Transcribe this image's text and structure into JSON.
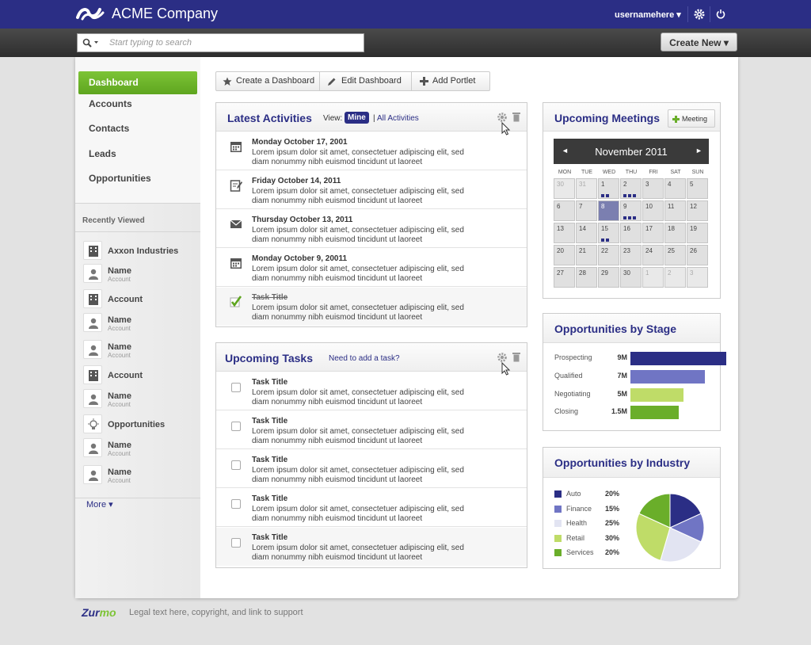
{
  "app": {
    "brand": "ACME Company",
    "username": "usernamehere ▾"
  },
  "search": {
    "placeholder": "Start typing to search"
  },
  "create_new": "Create New ▾",
  "nav": [
    {
      "label": "Dashboard",
      "active": true
    },
    {
      "label": "Accounts"
    },
    {
      "label": "Contacts"
    },
    {
      "label": "Leads"
    },
    {
      "label": "Opportunities"
    }
  ],
  "recently_viewed": {
    "title": "Recently Viewed",
    "items": [
      {
        "name": "Axxon Industries",
        "sub": "",
        "icon": "building-icon"
      },
      {
        "name": "Name",
        "sub": "Account",
        "icon": "person-icon"
      },
      {
        "name": "Account",
        "sub": "",
        "icon": "building-icon"
      },
      {
        "name": "Name",
        "sub": "Account",
        "icon": "person-icon"
      },
      {
        "name": "Name",
        "sub": "Account",
        "icon": "person-icon"
      },
      {
        "name": "Account",
        "sub": "",
        "icon": "building-icon"
      },
      {
        "name": "Name",
        "sub": "Account",
        "icon": "person-icon"
      },
      {
        "name": "Opportunities",
        "sub": "",
        "icon": "lightbulb-icon"
      },
      {
        "name": "Name",
        "sub": "Account",
        "icon": "person-icon"
      },
      {
        "name": "Name",
        "sub": "Account",
        "icon": "person-icon"
      }
    ],
    "more": "More ▾"
  },
  "toolbar": {
    "create": "Create a Dashboard",
    "edit": "Edit Dashboard",
    "add": "Add Portlet"
  },
  "latest": {
    "title": "Latest Activities",
    "view_label": "View:",
    "mine": "Mine",
    "sep": "|",
    "all": "All Activities",
    "rows": [
      {
        "title": "Monday October 17, 2001",
        "icon": "calendar-icon",
        "line1": "Lorem ipsum dolor sit amet, consectetuer adipiscing elit, sed",
        "line2": "diam nonummy nibh euismod tincidunt ut laoreet"
      },
      {
        "title": "Friday October 14, 2011",
        "icon": "note-icon",
        "line1": "Lorem ipsum dolor sit amet, consectetuer adipiscing elit, sed",
        "line2": "diam nonummy nibh euismod tincidunt ut laoreet"
      },
      {
        "title": "Thursday October 13, 2011",
        "icon": "envelope-icon",
        "line1": "Lorem ipsum dolor sit amet, consectetuer adipiscing elit, sed",
        "line2": "diam nonummy nibh euismod tincidunt ut laoreet"
      },
      {
        "title": "Monday October 9, 20011",
        "icon": "calendar-icon",
        "line1": "Lorem ipsum dolor sit amet, consectetuer adipiscing elit, sed",
        "line2": "diam nonummy nibh euismod tincidunt ut laoreet"
      },
      {
        "title": "Task Title",
        "icon": "checkmark-icon",
        "line1": "Lorem ipsum dolor sit amet, consectetuer adipiscing elit, sed",
        "line2": "diam nonummy nibh euismod tincidunt ut laoreet"
      }
    ]
  },
  "tasks": {
    "title": "Upcoming Tasks",
    "add_link": "Need to add a task?",
    "rows": [
      {
        "title": "Task Title",
        "line1": "Lorem ipsum dolor sit amet, consectetuer adipiscing elit, sed",
        "line2": "diam nonummy nibh euismod tincidunt ut laoreet"
      },
      {
        "title": "Task Title",
        "line1": "Lorem ipsum dolor sit amet, consectetuer adipiscing elit, sed",
        "line2": "diam nonummy nibh euismod tincidunt ut laoreet"
      },
      {
        "title": "Task Title",
        "line1": "Lorem ipsum dolor sit amet, consectetuer adipiscing elit, sed",
        "line2": "diam nonummy nibh euismod tincidunt ut laoreet"
      },
      {
        "title": "Task Title",
        "line1": "Lorem ipsum dolor sit amet, consectetuer adipiscing elit, sed",
        "line2": "diam nonummy nibh euismod tincidunt ut laoreet"
      },
      {
        "title": "Task Title",
        "line1": "Lorem ipsum dolor sit amet, consectetuer adipiscing elit, sed",
        "line2": "diam nonummy nibh euismod tincidunt ut laoreet"
      }
    ]
  },
  "meetings": {
    "title": "Upcoming Meetings",
    "button": "Meeting",
    "month": "November 2011",
    "prev": "◄",
    "next": "►",
    "dow": [
      "MON",
      "TUE",
      "WED",
      "THU",
      "FRI",
      "SAT",
      "SUN"
    ],
    "weeks": [
      [
        {
          "d": "30",
          "o": true
        },
        {
          "d": "31",
          "o": true
        },
        {
          "d": "1",
          "m": 2
        },
        {
          "d": "2",
          "m": 3
        },
        {
          "d": "3"
        },
        {
          "d": "4"
        },
        {
          "d": "5"
        }
      ],
      [
        {
          "d": "6"
        },
        {
          "d": "7"
        },
        {
          "d": "8",
          "today": true
        },
        {
          "d": "9",
          "m": 3
        },
        {
          "d": "10"
        },
        {
          "d": "11"
        },
        {
          "d": "12"
        }
      ],
      [
        {
          "d": "13"
        },
        {
          "d": "14"
        },
        {
          "d": "15",
          "m": 2
        },
        {
          "d": "16"
        },
        {
          "d": "17"
        },
        {
          "d": "18"
        },
        {
          "d": "19"
        }
      ],
      [
        {
          "d": "20"
        },
        {
          "d": "21"
        },
        {
          "d": "22"
        },
        {
          "d": "23"
        },
        {
          "d": "24"
        },
        {
          "d": "25"
        },
        {
          "d": "26"
        }
      ],
      [
        {
          "d": "27"
        },
        {
          "d": "28"
        },
        {
          "d": "29"
        },
        {
          "d": "30"
        },
        {
          "d": "1",
          "o": true
        },
        {
          "d": "2",
          "o": true
        },
        {
          "d": "3",
          "o": true
        }
      ]
    ]
  },
  "stage": {
    "title": "Opportunities by Stage",
    "max": 9,
    "rows": [
      {
        "name": "Prospecting",
        "label": "9M",
        "value": 9,
        "color": "#2b2e85"
      },
      {
        "name": "Qualified",
        "label": "7M",
        "value": 7,
        "color": "#7075c4"
      },
      {
        "name": "Negotiating",
        "label": "5M",
        "value": 5,
        "color": "#bfdc68"
      },
      {
        "name": "Closing",
        "label": "1.5M",
        "value": 4.5,
        "color": "#6aae2a"
      }
    ]
  },
  "industry": {
    "title": "Opportunities by Industry",
    "rows": [
      {
        "name": "Auto",
        "label": "20%",
        "value": 20,
        "color": "#2b2e85"
      },
      {
        "name": "Finance",
        "label": "15%",
        "value": 15,
        "color": "#7075c4"
      },
      {
        "name": "Health",
        "label": "25%",
        "value": 25,
        "color": "#e2e4f2"
      },
      {
        "name": "Retail",
        "label": "30%",
        "value": 30,
        "color": "#bfdc68"
      },
      {
        "name": "Services",
        "label": "20%",
        "value": 20,
        "color": "#6aae2a"
      }
    ]
  },
  "footer": {
    "logo_a": "Zur",
    "logo_b": "mo",
    "text": "Legal text here, copyright, and link to support"
  }
}
